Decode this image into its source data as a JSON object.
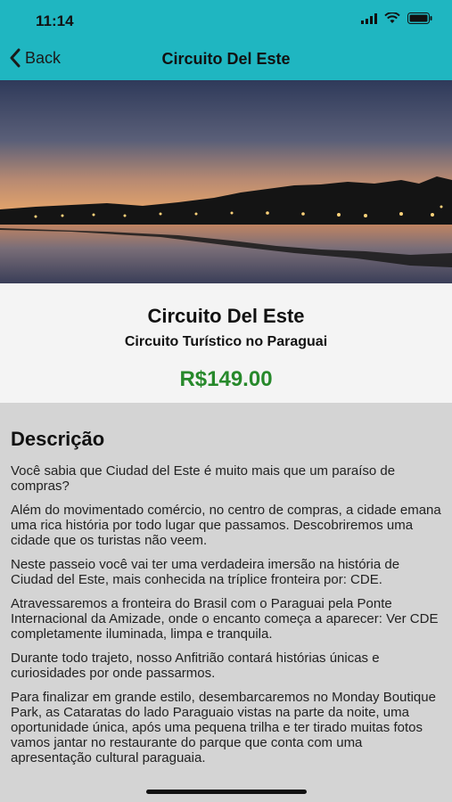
{
  "status_bar": {
    "time": "11:14"
  },
  "nav": {
    "back_label": "Back",
    "title": "Circuito Del Este"
  },
  "hero": {
    "image_description_icon": "lake-sunset-photo"
  },
  "product": {
    "title": "Circuito Del Este",
    "subtitle": "Circuito Turístico no Paraguai",
    "price": "R$149.00"
  },
  "description": {
    "heading": "Descrição",
    "paragraphs": [
      "Você sabia que Ciudad del Este é muito mais que um paraíso de compras?",
      "Além do movimentado comércio, no centro de compras, a cidade emana uma rica história por todo lugar que passamos. Descobriremos uma cidade que os turistas não veem.",
      "Neste passeio você vai ter uma verdadeira imersão na história de Ciudad del Este, mais conhecida na tríplice fronteira por: CDE.",
      "Atravessaremos a fronteira do Brasil com o Paraguai pela Ponte Internacional da Amizade, onde o encanto começa a aparecer: Ver CDE completamente iluminada, limpa e tranquila.",
      "Durante todo trajeto, nosso Anfitrião contará histórias únicas e curiosidades por onde passarmos.",
      "Para finalizar em grande estilo, desembarcaremos no Monday Boutique Park, as Cataratas do lado Paraguaio vistas na parte da noite, uma oportunidade única, após uma pequena trilha e ter tirado muitas fotos vamos jantar no restaurante do parque que conta com uma apresentação cultural paraguaia."
    ]
  },
  "colors": {
    "accent": "#1fb6c1",
    "price": "#27892b"
  }
}
